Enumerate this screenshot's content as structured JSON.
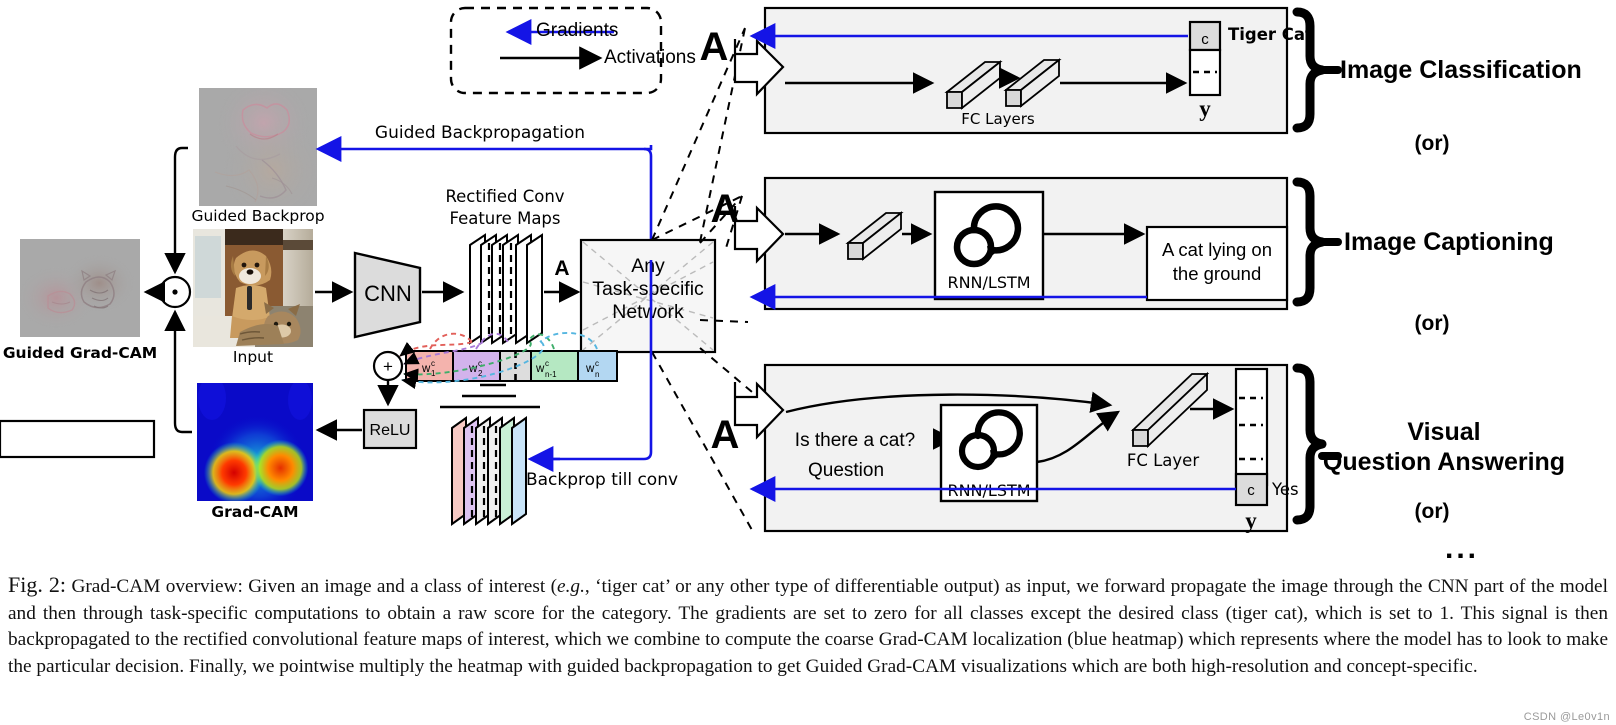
{
  "figure": {
    "legend": {
      "gradients": "Gradients",
      "activations": "Activations"
    },
    "labels": {
      "guided_backprop_img": "Guided Backprop",
      "input_img": "Input",
      "guided_gradcam_img": "Guided Grad-CAM",
      "gradcam_img": "Grad-CAM",
      "guided_backpropagation_arrow": "Guided Backpropagation",
      "backprop_till_conv_arrow": "Backprop till conv",
      "cnn": "CNN",
      "rectified_conv_feature_maps": "Rectified Conv\nFeature Maps",
      "rectified_line1": "Rectified Conv",
      "rectified_line2": "Feature Maps",
      "activations_symbol": "A",
      "task_network_line1": "Any",
      "task_network_line2": "Task-specific",
      "task_network_line3": "Network",
      "relu": "ReLU",
      "plus": "+"
    },
    "weights": [
      {
        "label": "w",
        "sub": "1",
        "sup": "c",
        "color": "#f4b3ad"
      },
      {
        "label": "w",
        "sub": "2",
        "sup": "c",
        "color": "#d3b3ec"
      },
      {
        "label": "",
        "sub": "",
        "sup": "",
        "color": "#dddddd"
      },
      {
        "label": "",
        "sub": "",
        "sup": "",
        "color": "#dddddd"
      },
      {
        "label": "w",
        "sub": "n-1",
        "sup": "c",
        "color": "#b5e8c2"
      },
      {
        "label": "w",
        "sub": "n",
        "sup": "c",
        "color": "#b3d7f2"
      }
    ],
    "tasks": [
      {
        "name": "Image Classification",
        "or": "(or)",
        "input_symbol": "A",
        "blocks": [
          "FC Layers"
        ],
        "output_vector_label": "y",
        "highlight_cell": "c",
        "output_text": "Tiger Cat"
      },
      {
        "name": "Image Captioning",
        "or": "(or)",
        "input_symbol": "A",
        "blocks": [
          "RNN/LSTM"
        ],
        "output_text_line1": "A cat lying on",
        "output_text_line2": "the ground"
      },
      {
        "name": "Visual\nQuestion Answering",
        "name_line1": "Visual",
        "name_line2": "Question Answering",
        "or": "(or)",
        "input_symbol": "A",
        "question_text": "Is there a cat?",
        "question_label": "Question",
        "blocks": [
          "RNN/LSTM",
          "FC Layer"
        ],
        "output_vector_label": "y",
        "highlight_cell": "c",
        "output_text": "Yes"
      }
    ],
    "ellipsis": "...",
    "colors": {
      "gradient_arrow": "#1414e6",
      "activation_arrow": "#000000",
      "panel_fill": "#f2f2f2",
      "block_fill": "#e0e0e0"
    }
  },
  "caption": {
    "figure_number": "Fig. 2:",
    "text_1": " Grad-CAM overview: Given an image and a class of interest (",
    "eg": "e.g.",
    "text_2": ", ‘tiger cat’ or any other type of differentiable output) as input, we forward propagate the image through the CNN part of the model and then through task-specific computations to obtain a raw score for the category. The gradients are set to zero for all classes except the desired class (tiger cat), which is set to 1. This signal is then backpropagated to the rectified convolutional feature maps of interest, which we combine to compute the coarse Grad-CAM localization (blue heatmap) which represents where the model has to look to make the particular decision. Finally, we pointwise multiply the heatmap with guided backpropagation to get Guided Grad-CAM visualizations which are both high-resolution and concept-specific."
  },
  "watermark": "CSDN @Le0v1n"
}
